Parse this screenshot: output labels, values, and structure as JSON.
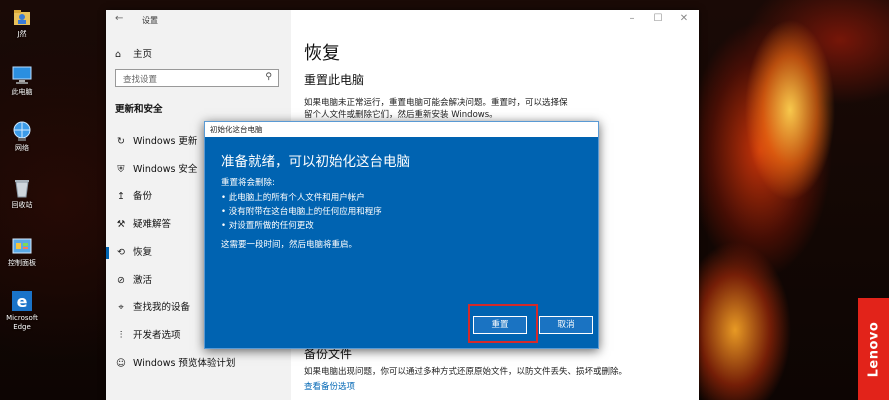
{
  "desktop": {
    "icons": [
      {
        "label": "J然",
        "icon": "user-folder-icon"
      },
      {
        "label": "此电脑",
        "icon": "computer-icon"
      },
      {
        "label": "网络",
        "icon": "network-icon"
      },
      {
        "label": "回收站",
        "icon": "recycle-bin-icon"
      },
      {
        "label": "控制面板",
        "icon": "control-panel-icon"
      },
      {
        "label": "Microsoft Edge",
        "icon": "edge-icon"
      }
    ],
    "brand": "Lenovo"
  },
  "settings": {
    "window_title": "设置",
    "home_label": "主页",
    "search_placeholder": "查找设置",
    "section_label": "更新和安全",
    "nav_items": [
      {
        "label": "Windows 更新",
        "icon": "sync-icon"
      },
      {
        "label": "Windows 安全",
        "icon": "shield-icon"
      },
      {
        "label": "备份",
        "icon": "backup-icon"
      },
      {
        "label": "疑难解答",
        "icon": "wrench-icon"
      },
      {
        "label": "恢复",
        "icon": "recovery-icon",
        "active": true
      },
      {
        "label": "激活",
        "icon": "activation-icon"
      },
      {
        "label": "查找我的设备",
        "icon": "find-device-icon"
      },
      {
        "label": "开发者选项",
        "icon": "developer-icon"
      },
      {
        "label": "Windows 预览体验计划",
        "icon": "insider-icon"
      }
    ],
    "page_title": "恢复",
    "reset_heading": "重置此电脑",
    "reset_text": "如果电脑未正常运行，重置电脑可能会解决问题。重置时，可以选择保留个人文件或删除它们，然后重新安装 Windows。",
    "backup_heading": "备份文件",
    "backup_text": "如果电脑出现问题，你可以通过多种方式还原原始文件，以防文件丢失、损坏或删除。",
    "backup_link": "查看备份选项"
  },
  "dialog": {
    "title": "初始化这台电脑",
    "heading": "准备就绪，可以初始化这台电脑",
    "subheading": "重置将会删除:",
    "bullets": [
      "• 此电脑上的所有个人文件和用户帐户",
      "• 没有附带在这台电脑上的任何应用和程序",
      "• 对设置所做的任何更改"
    ],
    "note": "这需要一段时间，然后电脑将重启。",
    "reset_button": "重置",
    "cancel_button": "取消"
  },
  "colors": {
    "accent": "#0063b1",
    "highlight": "#d42a2a",
    "brand": "#e2231a"
  }
}
